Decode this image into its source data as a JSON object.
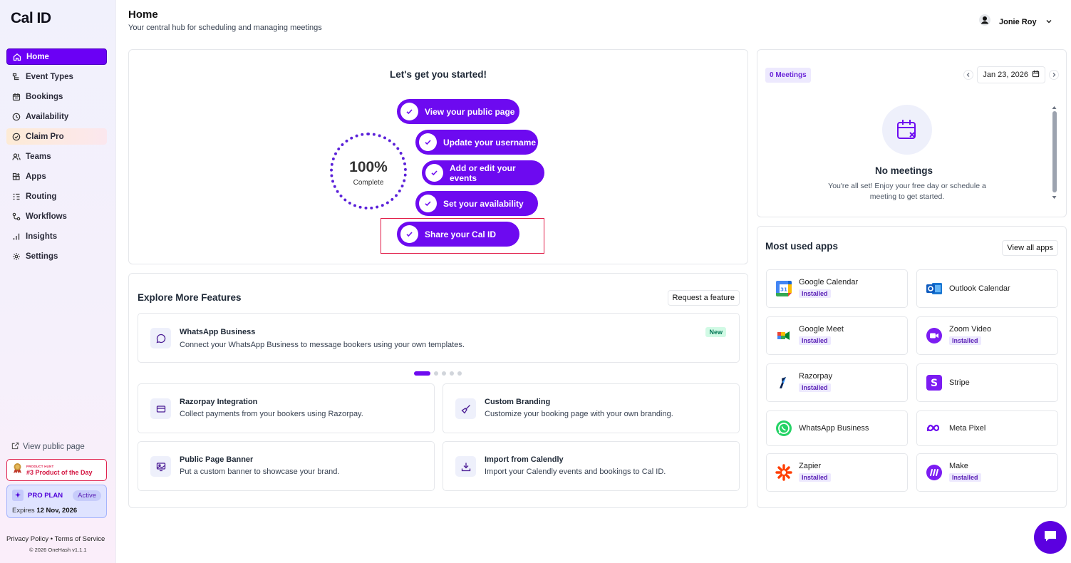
{
  "app": {
    "logo": "Cal ID"
  },
  "sidebar": {
    "items": [
      {
        "label": "Home",
        "icon": "home-icon"
      },
      {
        "label": "Event Types",
        "icon": "event-types-icon"
      },
      {
        "label": "Bookings",
        "icon": "calendar-icon"
      },
      {
        "label": "Availability",
        "icon": "clock-icon"
      },
      {
        "label": "Claim Pro",
        "icon": "badge-icon"
      },
      {
        "label": "Teams",
        "icon": "users-icon"
      },
      {
        "label": "Apps",
        "icon": "apps-icon"
      },
      {
        "label": "Routing",
        "icon": "routing-icon"
      },
      {
        "label": "Workflows",
        "icon": "workflow-icon"
      },
      {
        "label": "Insights",
        "icon": "bar-chart-icon"
      },
      {
        "label": "Settings",
        "icon": "gear-icon"
      }
    ],
    "view_public_page": "View public page",
    "product_hunt": {
      "small": "PRODUCT HUNT",
      "big": "#3 Product of the Day"
    },
    "pro_plan": {
      "title": "PRO PLAN",
      "status": "Active",
      "expires_label": "Expires",
      "expires_date": "12 Nov, 2026"
    },
    "footer": {
      "privacy": "Privacy Policy",
      "sep": "•",
      "terms": "Terms of Service",
      "copyright": "© 2026 OneHash v1.1.1"
    }
  },
  "header": {
    "title": "Home",
    "subtitle": "Your central hub for scheduling and managing meetings",
    "user_name": "Jonie Roy"
  },
  "getting_started": {
    "title": "Let's get you started!",
    "progress_percent": "100%",
    "progress_label": "Complete",
    "steps": [
      "View your public page",
      "Update your username",
      "Add or edit your events",
      "Set your availability",
      "Share your Cal ID"
    ]
  },
  "meetings": {
    "badge": "0 Meetings",
    "date": "Jan 23, 2026",
    "empty_title": "No meetings",
    "empty_sub": "You're all set! Enjoy your free day or schedule a meeting to get started."
  },
  "apps": {
    "title": "Most used apps",
    "view_all": "View all apps",
    "installed_label": "Installed",
    "items": [
      {
        "name": "Google Calendar",
        "installed": true
      },
      {
        "name": "Outlook Calendar",
        "installed": false
      },
      {
        "name": "Google Meet",
        "installed": true
      },
      {
        "name": "Zoom Video",
        "installed": true
      },
      {
        "name": "Razorpay",
        "installed": true
      },
      {
        "name": "Stripe",
        "installed": false
      },
      {
        "name": "WhatsApp Business",
        "installed": false
      },
      {
        "name": "Meta Pixel",
        "installed": false
      },
      {
        "name": "Zapier",
        "installed": true
      },
      {
        "name": "Make",
        "installed": true
      }
    ]
  },
  "explore": {
    "title": "Explore More Features",
    "request_button": "Request a feature",
    "carousel": {
      "title": "WhatsApp Business",
      "desc": "Connect your WhatsApp Business to message bookers using your own templates.",
      "badge": "New"
    },
    "features": [
      {
        "title": "Razorpay Integration",
        "desc": "Collect payments from your bookers using Razorpay."
      },
      {
        "title": "Custom Branding",
        "desc": "Customize your booking page with your own branding."
      },
      {
        "title": "Public Page Banner",
        "desc": "Put a custom banner to showcase your brand."
      },
      {
        "title": "Import from Calendly",
        "desc": "Import your Calendly events and bookings to Cal ID."
      }
    ]
  },
  "colors": {
    "accent": "#6d0af0",
    "highlight": "#e11d48",
    "ring": "#5b21d9"
  }
}
